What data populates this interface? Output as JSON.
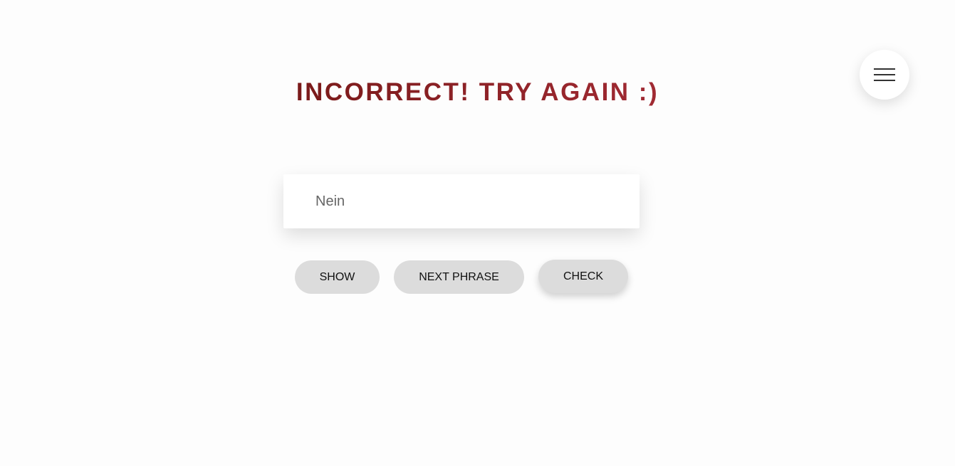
{
  "feedback": {
    "message": "INCORRECT! TRY AGAIN :)"
  },
  "answer": {
    "value": "Nein"
  },
  "buttons": {
    "show": "SHOW",
    "next_phrase": "NEXT PHRASE",
    "check": "CHECK"
  },
  "menu": {
    "icon": "hamburger-menu-icon"
  },
  "colors": {
    "feedback_start": "#7a1a1a",
    "feedback_end": "#a12a33",
    "button_bg": "#dcdcdc"
  }
}
